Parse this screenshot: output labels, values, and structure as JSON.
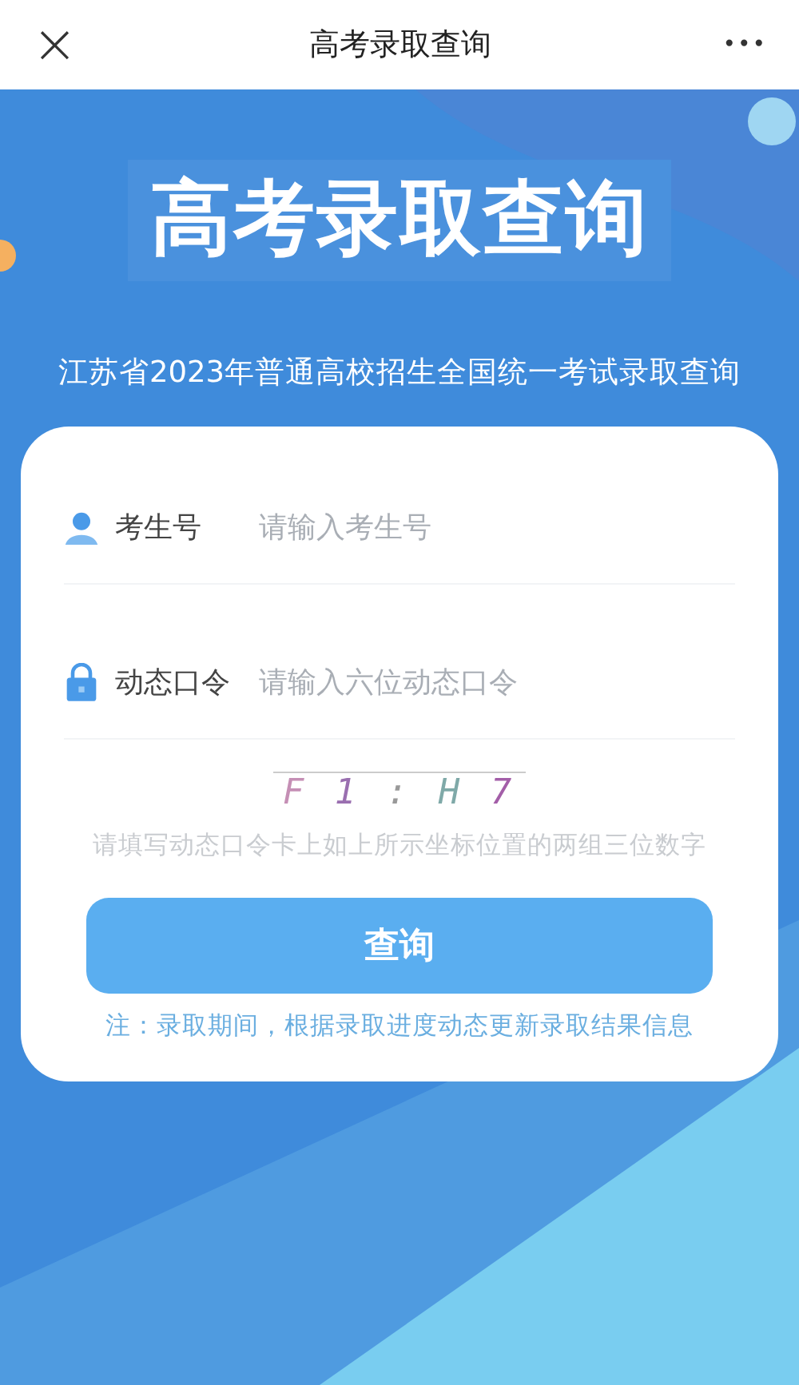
{
  "nav_bar": {
    "close": "×",
    "title": "高考录取查询",
    "more": "•••"
  },
  "banner": {
    "title": "高考录取查询",
    "subtitle": "江苏省2023年普通高校招生全国统一考试录取查询"
  },
  "form": {
    "fields": [
      {
        "kind": "user",
        "label": "考生号",
        "placeholder": "请输入考生号"
      },
      {
        "kind": "lock",
        "label": "动态口令",
        "placeholder": "请输入六位动态口令"
      }
    ],
    "captcha": "F 1 : H 7",
    "hint": "请填写动态口令卡上如上所示坐标位置的两组三位数字",
    "submit": "查询",
    "note": "注：录取期间，根据录取进度动态更新录取结果信息"
  }
}
